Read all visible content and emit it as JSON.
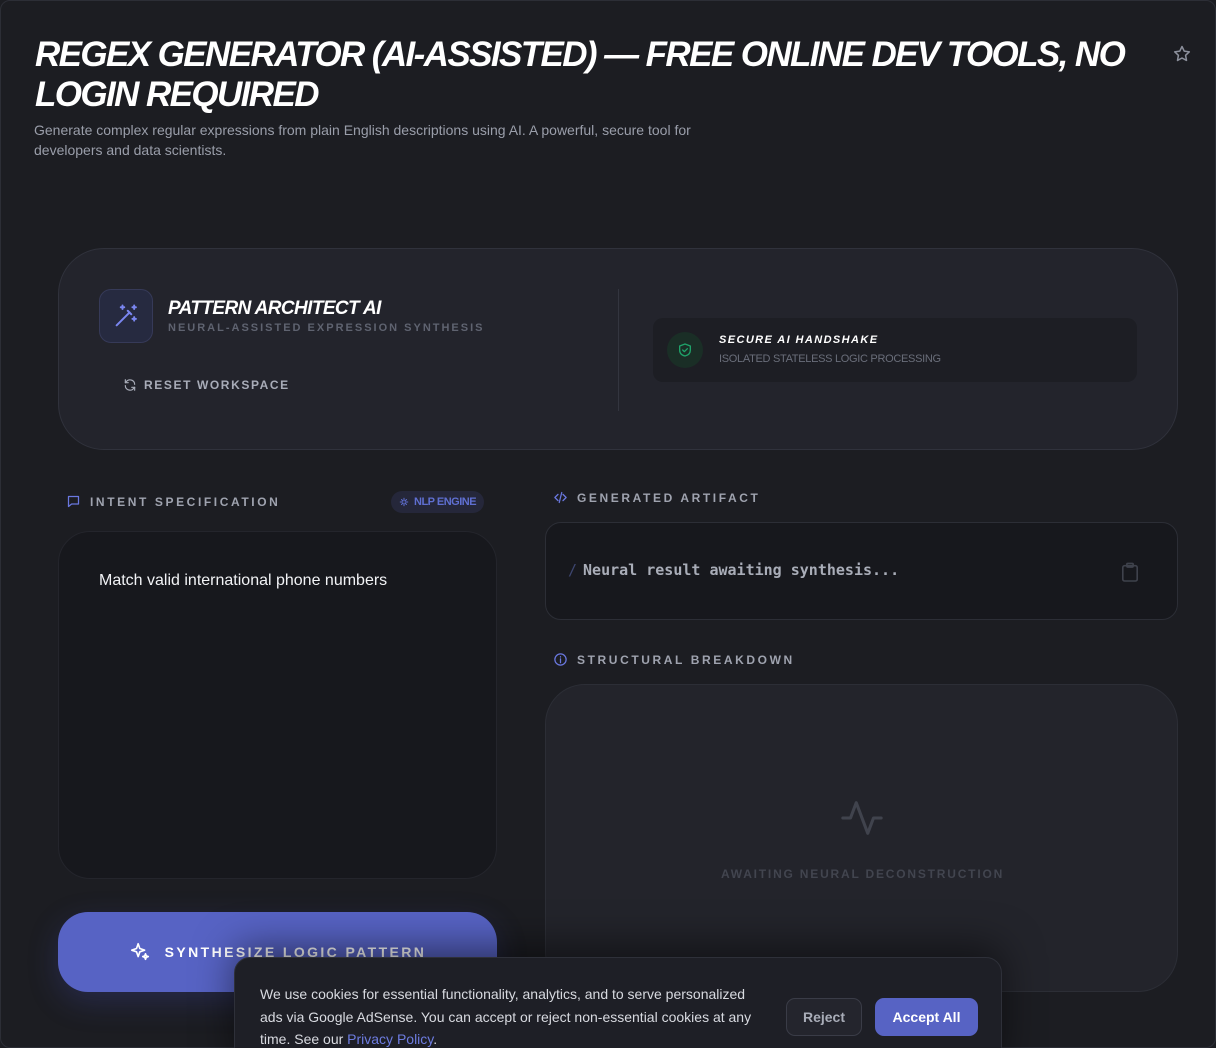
{
  "page": {
    "title": "REGEX GENERATOR (AI-ASSISTED) — FREE ONLINE DEV TOOLS, NO LOGIN REQUIRED",
    "subtitle": "Generate complex regular expressions from plain English descriptions using AI. A powerful, secure tool for developers and data scientists.",
    "favorite_icon": "star-outline-icon"
  },
  "header_card": {
    "logo_icon": "magic-wand-icon",
    "brand_title": "PATTERN ARCHITECT AI",
    "brand_subtitle": "NEURAL-ASSISTED EXPRESSION SYNTHESIS",
    "reset_label": "RESET WORKSPACE",
    "reset_icon": "refresh-icon",
    "secure": {
      "icon": "shield-check-icon",
      "title": "SECURE AI HANDSHAKE",
      "subtitle": "ISOLATED STATELESS LOGIC PROCESSING"
    }
  },
  "intent": {
    "label": "INTENT SPECIFICATION",
    "label_icon": "chat-bubble-icon",
    "badge": "NLP ENGINE",
    "badge_icon": "sparkle-icon",
    "value": "Match valid international phone numbers"
  },
  "synthesize_button": {
    "label": "SYNTHESIZE LOGIC PATTERN",
    "icon": "sparkles-icon"
  },
  "artifact": {
    "label": "GENERATED ARTIFACT",
    "label_icon": "code-icon",
    "slash": "/",
    "placeholder": "Neural result awaiting synthesis...",
    "copy_icon": "clipboard-icon"
  },
  "breakdown": {
    "label": "STRUCTURAL BREAKDOWN",
    "label_icon": "info-circle-icon",
    "empty_icon": "activity-wave-icon",
    "empty_text": "AWAITING NEURAL DECONSTRUCTION"
  },
  "cookie_banner": {
    "text": "We use cookies for essential functionality, analytics, and to serve personalized ads via Google AdSense. You can accept or reject non-essential cookies at any time. See our ",
    "link": "Privacy Policy",
    "suffix": ".",
    "reject_label": "Reject",
    "accept_label": "Accept All"
  },
  "colors": {
    "background": "#1c1d22",
    "accent": "#5763c4",
    "secure_green": "#1fa36a"
  }
}
